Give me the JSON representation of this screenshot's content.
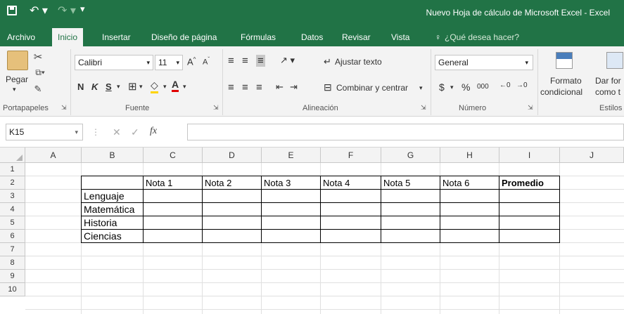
{
  "title_bar": {
    "title": "Nuevo Hoja de cálculo de Microsoft Excel - Excel"
  },
  "tabs": [
    {
      "label": "Archivo"
    },
    {
      "label": "Inicio"
    },
    {
      "label": "Insertar"
    },
    {
      "label": "Diseño de página"
    },
    {
      "label": "Fórmulas"
    },
    {
      "label": "Datos"
    },
    {
      "label": "Revisar"
    },
    {
      "label": "Vista"
    }
  ],
  "tell_me": "¿Qué desea hacer?",
  "ribbon": {
    "paste_label": "Pegar",
    "font_name": "Calibri",
    "font_size": "11",
    "bold": "N",
    "italic": "K",
    "underline": "S",
    "wrap_text": "Ajustar texto",
    "merge_center": "Combinar y centrar",
    "number_format": "General",
    "currency": "$",
    "percent": "%",
    "thousands": "000",
    "cond_format_line1": "Formato",
    "cond_format_line2": "condicional",
    "format_table_line1": "Dar for",
    "format_table_line2": "como t",
    "groups": {
      "clipboard": "Portapapeles",
      "font": "Fuente",
      "alignment": "Alineación",
      "number": "Número",
      "styles": "Estilos"
    }
  },
  "formula_bar": {
    "name_box": "K15",
    "fx": "fx",
    "value": ""
  },
  "sheet": {
    "columns": [
      "A",
      "B",
      "C",
      "D",
      "E",
      "F",
      "G",
      "H",
      "I",
      "J"
    ],
    "rows": [
      "1",
      "2",
      "3",
      "4",
      "5",
      "6",
      "7",
      "8",
      "9",
      "10"
    ],
    "header_row": [
      "Nota 1",
      "Nota 2",
      "Nota 3",
      "Nota 4",
      "Nota 5",
      "Nota 6",
      "Promedio"
    ],
    "subjects": [
      "Lenguaje",
      "Matemática",
      "Historia",
      "Ciencias"
    ]
  },
  "colors": {
    "accent": "#217346"
  }
}
